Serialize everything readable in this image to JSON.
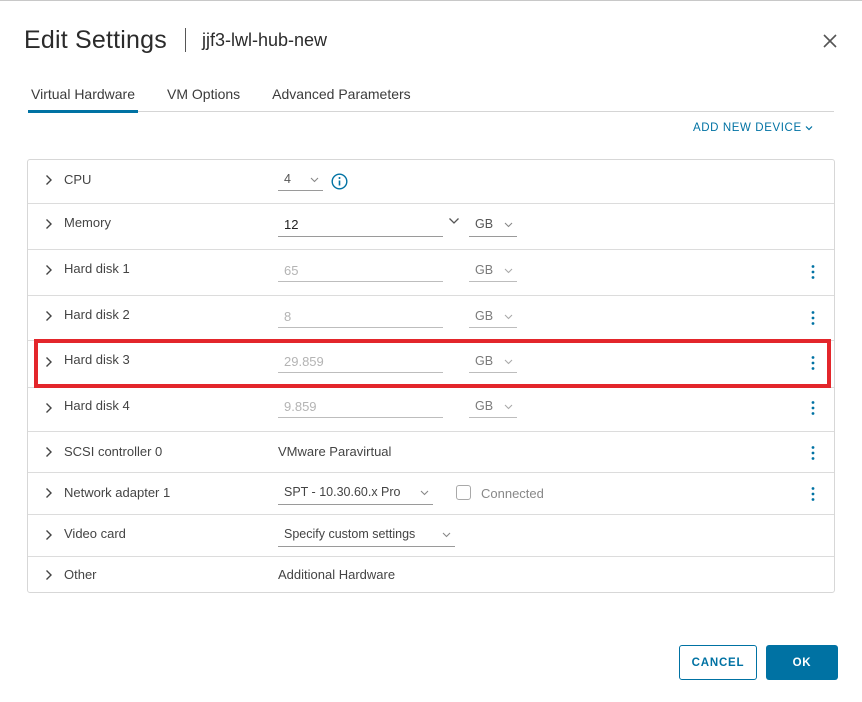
{
  "dialog": {
    "title": "Edit Settings",
    "subtitle": "jjf3-lwl-hub-new",
    "close_icon": "close-icon"
  },
  "tabs": [
    {
      "label": "Virtual Hardware",
      "active": true
    },
    {
      "label": "VM Options",
      "active": false
    },
    {
      "label": "Advanced Parameters",
      "active": false
    }
  ],
  "add_device_label": "ADD NEW DEVICE",
  "hardware": {
    "cpu": {
      "label": "CPU",
      "value": "4"
    },
    "memory": {
      "label": "Memory",
      "value": "12",
      "unit": "GB"
    },
    "hard_disk_1": {
      "label": "Hard disk 1",
      "value": "65",
      "unit": "GB"
    },
    "hard_disk_2": {
      "label": "Hard disk 2",
      "value": "8",
      "unit": "GB"
    },
    "hard_disk_3": {
      "label": "Hard disk 3",
      "value": "29.859",
      "unit": "GB"
    },
    "hard_disk_4": {
      "label": "Hard disk 4",
      "value": "9.859",
      "unit": "GB"
    },
    "scsi": {
      "label": "SCSI controller 0",
      "value": "VMware Paravirtual"
    },
    "network": {
      "label": "Network adapter 1",
      "value": "SPT - 10.30.60.x Pro",
      "connected_label": "Connected",
      "connected": false
    },
    "video": {
      "label": "Video card",
      "value": "Specify custom settings"
    },
    "other": {
      "label": "Other",
      "value": "Additional Hardware"
    }
  },
  "footer": {
    "cancel_label": "CANCEL",
    "ok_label": "OK"
  },
  "colors": {
    "accent": "#0072a3",
    "highlight": "#e3262b"
  }
}
